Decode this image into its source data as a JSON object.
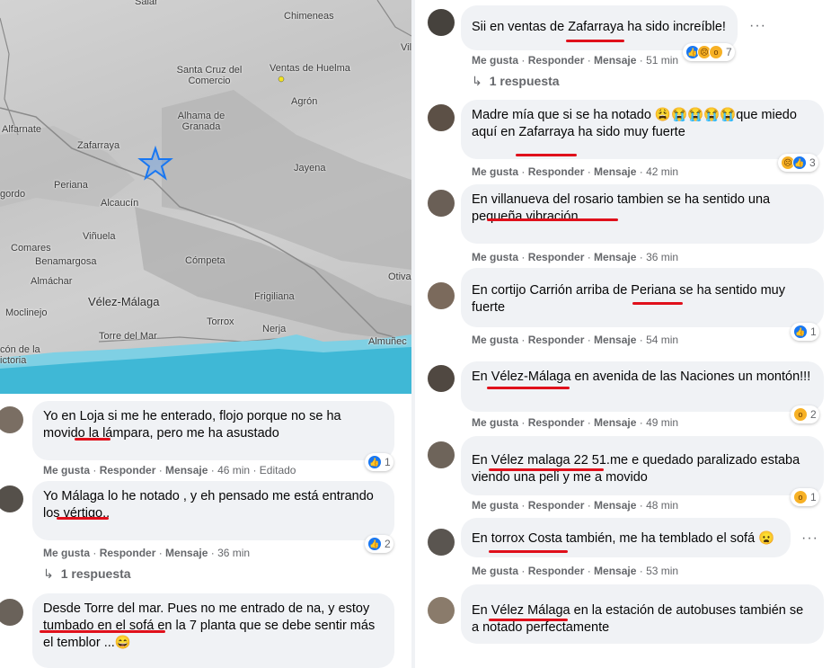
{
  "map": {
    "labels": {
      "salar": "Salar",
      "chimeneas": "Chimeneas",
      "vil": "Vil",
      "santa_cruz": "Santa Cruz del\nComercio",
      "ventas_huelma": "Ventas de Huelma",
      "agron": "Agrón",
      "alfarnate": "Alfarnate",
      "alhama": "Alhama de\nGranada",
      "zafarraya": "Zafarraya",
      "jayena": "Jayena",
      "periana": "Periana",
      "gordo": "gordo",
      "alcaucin": "Alcaucín",
      "vinuela": "Viñuela",
      "comares": "Comares",
      "benamargosa": "Benamargosa",
      "competa": "Cómpeta",
      "almachar": "Almáchar",
      "otiva": "Otiva",
      "velez": "Vélez-Málaga",
      "frigiliana": "Frigiliana",
      "moclinejo": "Moclinejo",
      "torrox": "Torrox",
      "nerja": "Nerja",
      "rincon": "cón de la\nictoria",
      "torre_mar": "Torre del Mar",
      "almunecar": "Almuñec"
    },
    "colors": {
      "sea": "#3fb8d6",
      "sea_light": "#7fd0e4",
      "land": "#cccccc",
      "epicenter": "#1877f2"
    }
  },
  "left_comments": [
    {
      "text": "Yo en Loja si me he enterado, flojo porque no se ha movido la lámpara, pero me ha asustado",
      "actions": {
        "like": "Me gusta",
        "reply": "Responder",
        "message": "Mensaje",
        "time": "46 min",
        "edited": "Editado"
      },
      "reaction_count": "1"
    },
    {
      "text": "Yo Málaga lo he notado , y eh pensado me está entrando los vértigo..",
      "actions": {
        "like": "Me gusta",
        "reply": "Responder",
        "message": "Mensaje",
        "time": "36 min"
      },
      "reaction_count": "2",
      "replies": "1 respuesta"
    },
    {
      "text": "Desde Torre del mar. Pues no me entrado de na, y estoy tumbado en el sofá en la 7 planta que se debe sentir más el temblor ...😄"
    }
  ],
  "right_comments": [
    {
      "text": "Sii en ventas de Zafarraya ha sido increíble!",
      "actions": {
        "like": "Me gusta",
        "reply": "Responder",
        "message": "Mensaje",
        "time": "51 min"
      },
      "reaction_count": "7",
      "replies": "1 respuesta"
    },
    {
      "text": "Madre mía que si se ha notado 😩😭😭😭😭que miedo aquí en Zafarraya ha sido muy fuerte",
      "actions": {
        "like": "Me gusta",
        "reply": "Responder",
        "message": "Mensaje",
        "time": "42 min"
      },
      "reaction_count": "3"
    },
    {
      "text": "En villanueva del rosario tambien se ha sentido una pequeña vibración",
      "actions": {
        "like": "Me gusta",
        "reply": "Responder",
        "message": "Mensaje",
        "time": "36 min"
      }
    },
    {
      "text": "En cortijo Carrión arriba de Periana se ha sentido muy fuerte",
      "actions": {
        "like": "Me gusta",
        "reply": "Responder",
        "message": "Mensaje",
        "time": "54 min"
      },
      "reaction_count": "1"
    },
    {
      "text": "En Vélez-Málaga en avenida de las Naciones un montón!!!",
      "actions": {
        "like": "Me gusta",
        "reply": "Responder",
        "message": "Mensaje",
        "time": "49 min"
      },
      "reaction_count": "2"
    },
    {
      "text": "En Vélez malaga 22 51.me e quedado paralizado estaba viendo una peli y me a movido",
      "actions": {
        "like": "Me gusta",
        "reply": "Responder",
        "message": "Mensaje",
        "time": "48 min"
      },
      "reaction_count": "1"
    },
    {
      "text": "En torrox Costa también, me ha temblado el sofá 😦",
      "actions": {
        "like": "Me gusta",
        "reply": "Responder",
        "message": "Mensaje",
        "time": "53 min"
      }
    },
    {
      "text": "En Vélez Málaga en la estación de autobuses también se a notado perfectamente"
    }
  ],
  "icons": {
    "more": "more-options-icon",
    "reply_arrow": "reply-arrow-icon"
  }
}
